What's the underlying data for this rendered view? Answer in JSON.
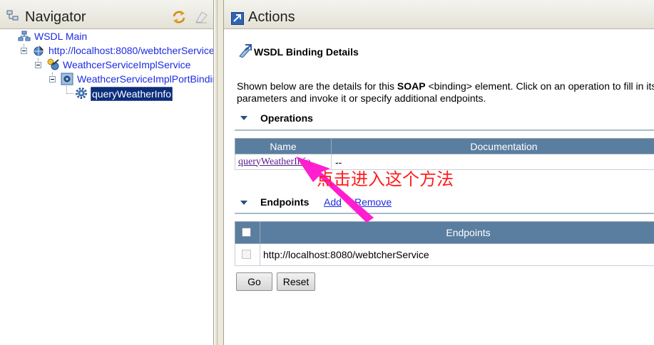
{
  "colors": {
    "accent_blue": "#1c2be2",
    "annotation_red": "#ff1d1d",
    "arrow_magenta": "#ff1ed0",
    "header_bar": "#5a7ea0",
    "selection": "#0b2d7c"
  },
  "navigator": {
    "title": "Navigator",
    "tools": [
      "refresh-icon",
      "clear-icon"
    ],
    "tree": [
      {
        "label": "WSDL Main",
        "icon": "wsdl-main-icon"
      },
      {
        "label": "http://localhost:8080/webtcherService",
        "icon": "wsdl-service-icon"
      },
      {
        "label": "WeathcerServiceImplService",
        "icon": "service-icon"
      },
      {
        "label": "WeathcerServiceImplPortBinding",
        "icon": "binding-icon"
      },
      {
        "label": "queryWeatherInfo",
        "icon": "operation-gear-icon",
        "selected": true
      }
    ]
  },
  "actions": {
    "title": "Actions",
    "heading": "WSDL Binding Details",
    "description_prefix": "Shown below are the details for this ",
    "description_bold": "SOAP",
    "description_rest": " <binding> element. Click on an operation to fill in its",
    "description_line2": "parameters and invoke it or specify additional endpoints.",
    "operations": {
      "title": "Operations",
      "columns": [
        "Name",
        "Documentation"
      ],
      "rows": [
        {
          "name": "queryWeatherInfo",
          "documentation": "--"
        }
      ]
    },
    "endpoints": {
      "title": "Endpoints",
      "add_label": "Add",
      "remove_label": "Remove",
      "column": "Endpoints",
      "rows": [
        {
          "url": "http://localhost:8080/webtcherService",
          "checked": false
        }
      ]
    },
    "buttons": {
      "go": "Go",
      "reset": "Reset"
    }
  },
  "annotation": {
    "text": "点击进入这个方法"
  }
}
